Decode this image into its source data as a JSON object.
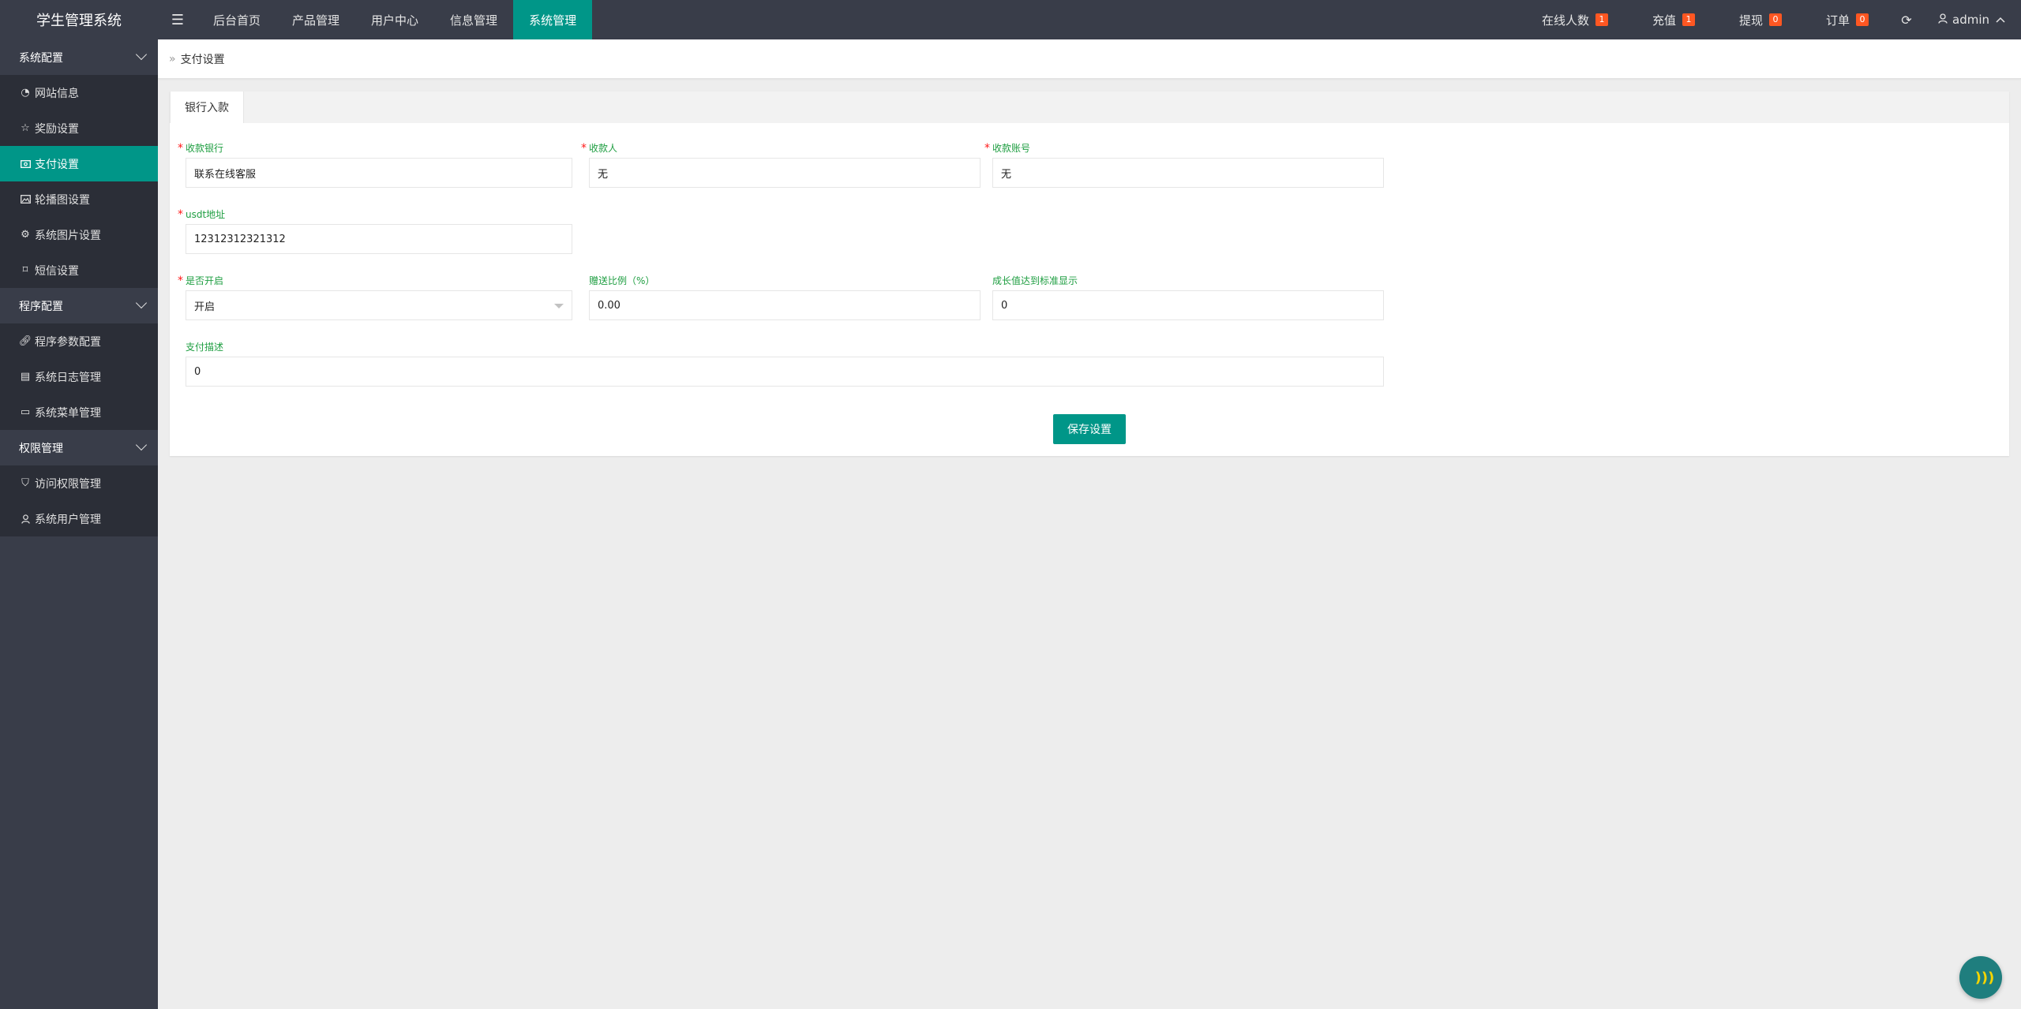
{
  "app": {
    "title": "学生管理系统"
  },
  "topnav": {
    "items": [
      {
        "label": "后台首页"
      },
      {
        "label": "产品管理"
      },
      {
        "label": "用户中心"
      },
      {
        "label": "信息管理"
      },
      {
        "label": "系统管理",
        "active": true
      }
    ],
    "stats": [
      {
        "label": "在线人数",
        "count": "1"
      },
      {
        "label": "充值",
        "count": "1"
      },
      {
        "label": "提现",
        "count": "0"
      },
      {
        "label": "订单",
        "count": "0"
      }
    ],
    "user": "admin"
  },
  "sidebar": {
    "groups": [
      {
        "title": "系统配置",
        "items": [
          {
            "label": "网站信息",
            "icon": "gauge-icon"
          },
          {
            "label": "奖励设置",
            "icon": "star-icon"
          },
          {
            "label": "支付设置",
            "icon": "money-icon",
            "active": true
          },
          {
            "label": "轮播图设置",
            "icon": "image-icon"
          },
          {
            "label": "系统图片设置",
            "icon": "gear-icon"
          },
          {
            "label": "短信设置",
            "icon": "tag-icon"
          }
        ]
      },
      {
        "title": "程序配置",
        "items": [
          {
            "label": "程序参数配置",
            "icon": "link-icon"
          },
          {
            "label": "系统日志管理",
            "icon": "log-icon"
          },
          {
            "label": "系统菜单管理",
            "icon": "calendar-icon"
          }
        ]
      },
      {
        "title": "权限管理",
        "items": [
          {
            "label": "访问权限管理",
            "icon": "shield-check-icon"
          },
          {
            "label": "系统用户管理",
            "icon": "user-icon"
          }
        ]
      }
    ]
  },
  "breadcrumb": {
    "current": "支付设置"
  },
  "tabs": [
    {
      "label": "银行入款"
    }
  ],
  "form": {
    "bank": {
      "label": "收款银行",
      "value": "联系在线客服"
    },
    "payee": {
      "label": "收款人",
      "value": "无"
    },
    "account": {
      "label": "收款账号",
      "value": "无"
    },
    "usdt": {
      "label": "usdt地址",
      "value": "12312312321312"
    },
    "enabled": {
      "label": "是否开启",
      "value": "开启"
    },
    "bonus_rate": {
      "label": "赠送比例（%）",
      "value": "0.00"
    },
    "growth": {
      "label": "成长值达到标准显示",
      "value": "0"
    },
    "desc": {
      "label": "支付描述",
      "value": "0"
    }
  },
  "save_label": "保存设置",
  "colors": {
    "accent": "#009688",
    "badge": "#ff5722",
    "topbar": "#393d49",
    "label": "#1e9e41"
  }
}
